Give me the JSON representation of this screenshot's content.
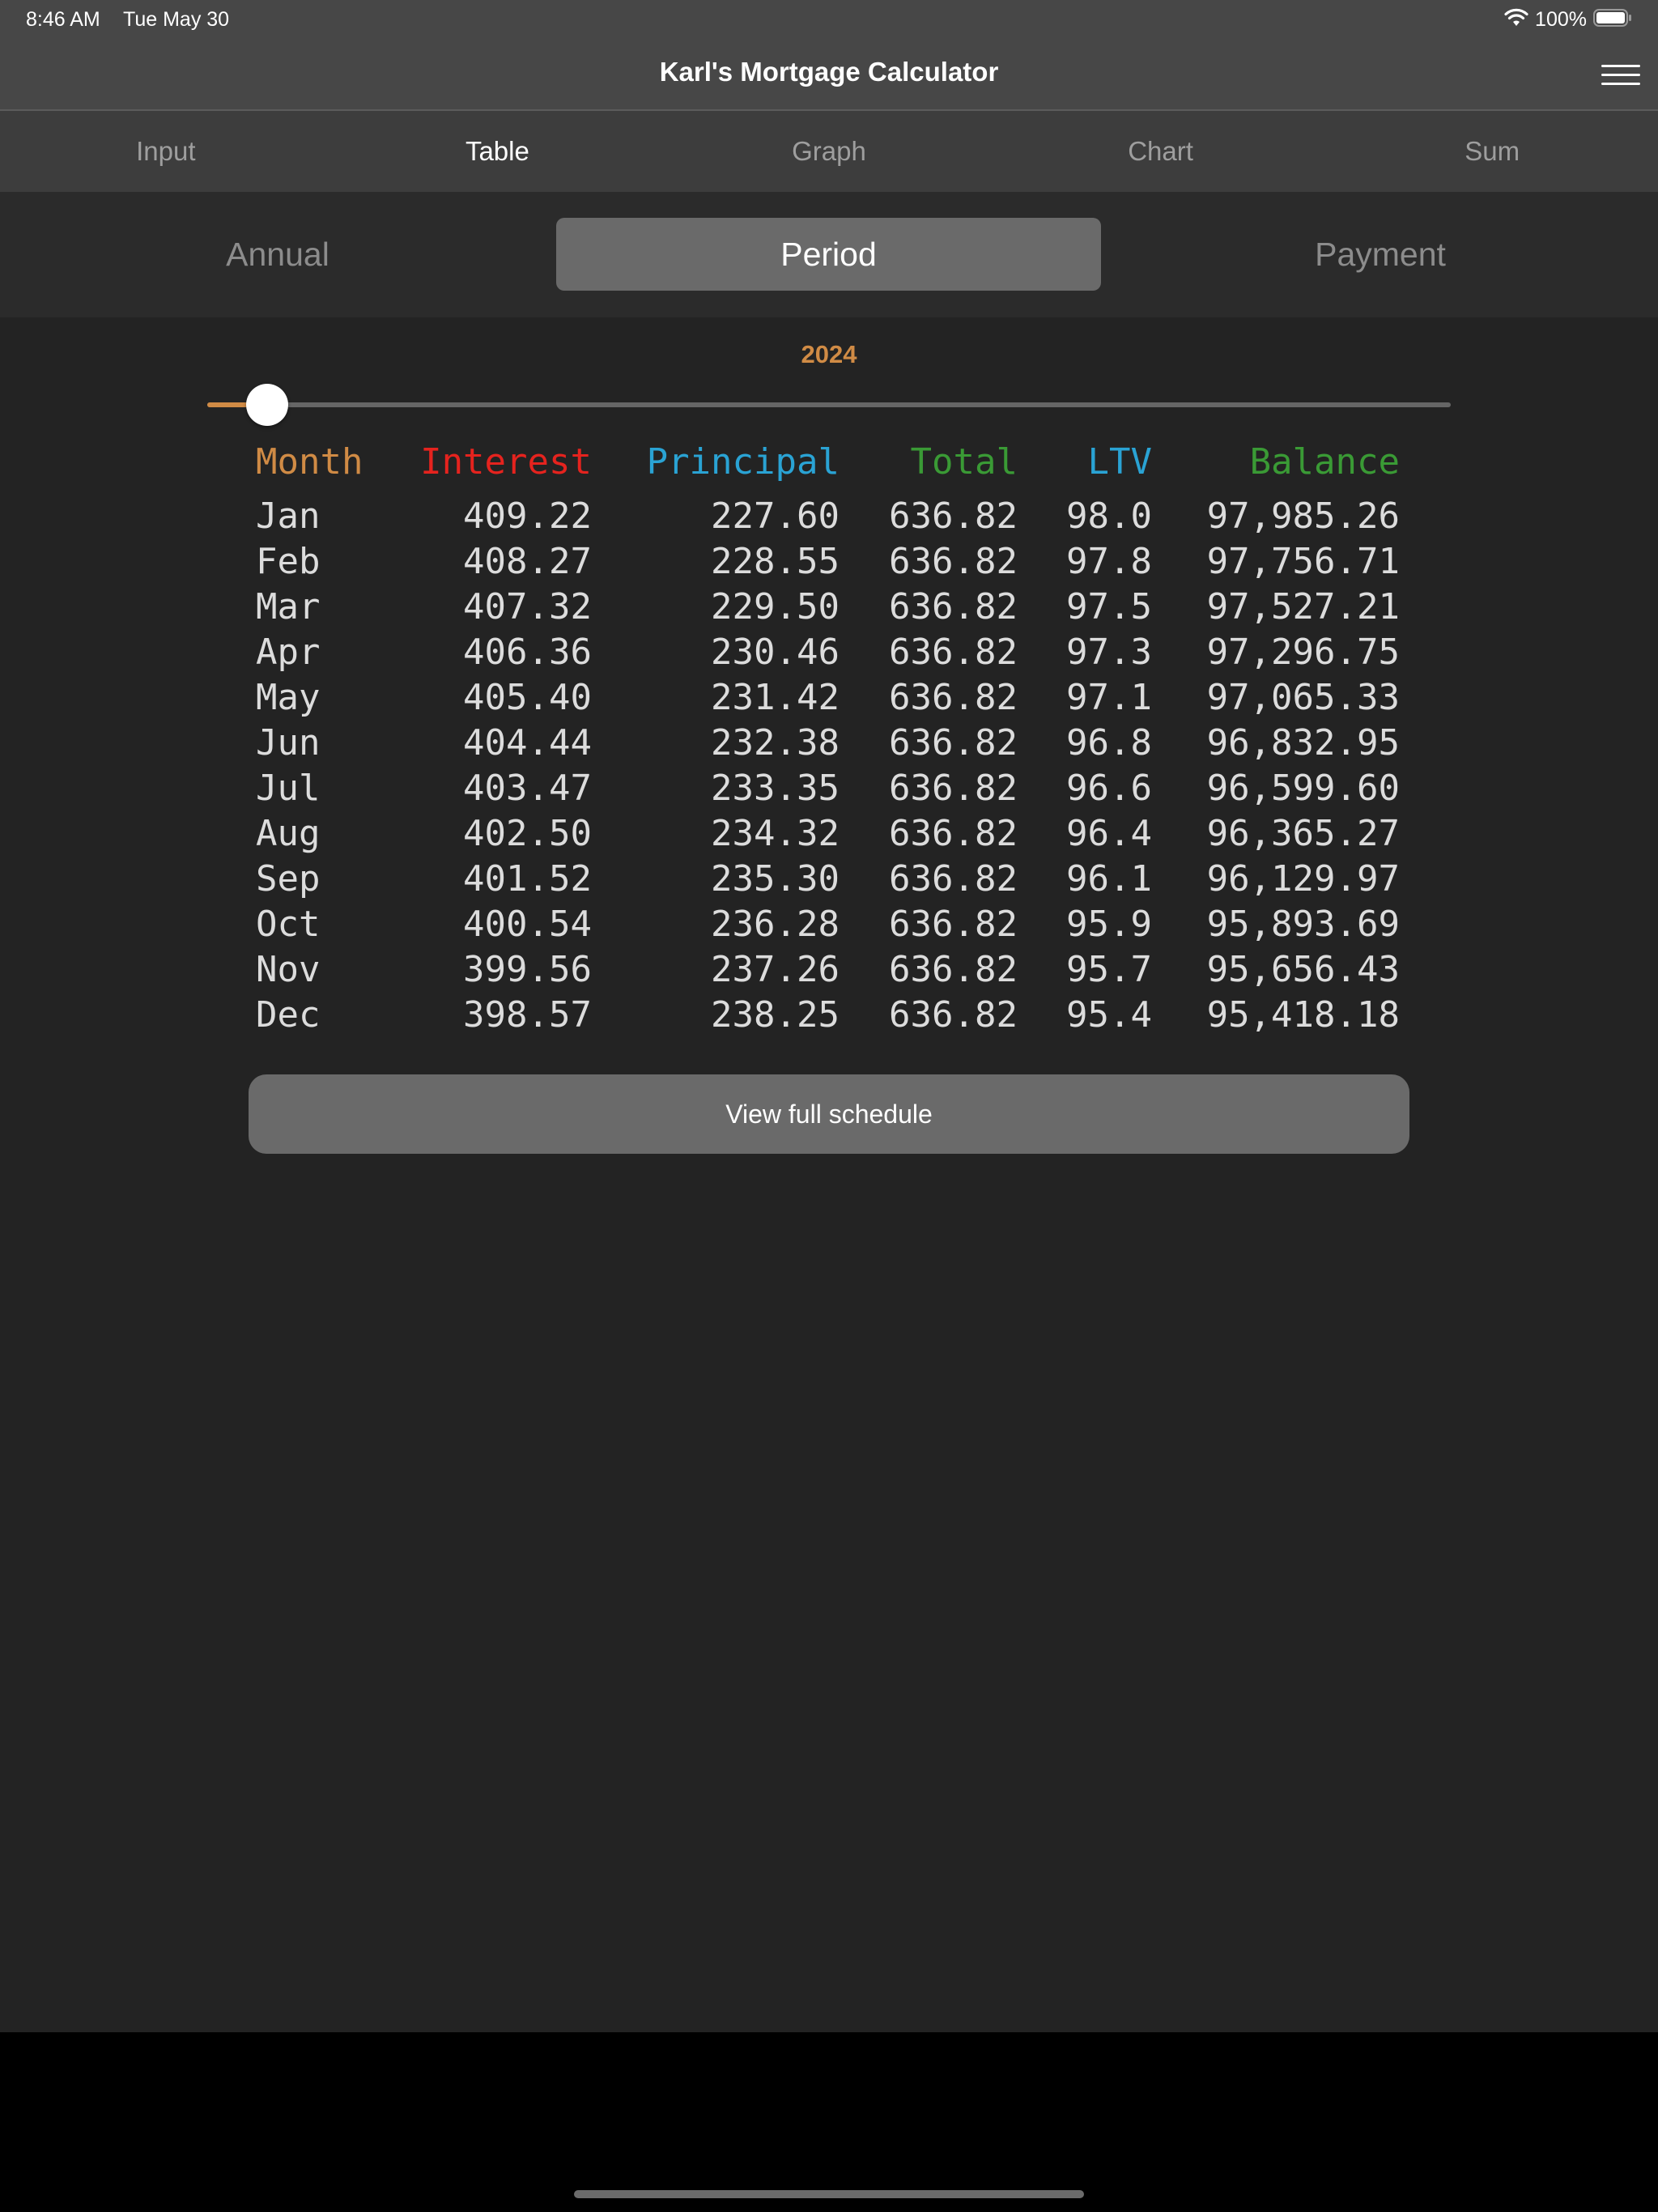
{
  "status_bar": {
    "time": "8:46 AM",
    "date": "Tue May 30",
    "battery": "100%",
    "icons": [
      "wifi-icon",
      "battery-icon"
    ]
  },
  "header": {
    "title": "Karl's Mortgage Calculator",
    "menu_icon": "hamburger-menu-icon"
  },
  "tabs": [
    {
      "label": "Input",
      "active": false
    },
    {
      "label": "Table",
      "active": true
    },
    {
      "label": "Graph",
      "active": false
    },
    {
      "label": "Chart",
      "active": false
    },
    {
      "label": "Sum",
      "active": false
    }
  ],
  "segments": [
    {
      "label": "Annual",
      "selected": false
    },
    {
      "label": "Period",
      "selected": true
    },
    {
      "label": "Payment",
      "selected": false
    }
  ],
  "year_selector": {
    "year": "2024",
    "slider_fraction": 0.048
  },
  "table": {
    "headers": {
      "month": "Month",
      "interest": "Interest",
      "principal": "Principal",
      "total": "Total",
      "ltv": "LTV",
      "balance": "Balance"
    },
    "header_colors": {
      "month": "#d08b45",
      "interest": "#e5231e",
      "principal": "#2aa3d4",
      "total": "#3a9a35",
      "ltv": "#2aa3d4",
      "balance": "#3a9a35"
    },
    "rows": [
      {
        "month": "Jan",
        "interest": "409.22",
        "principal": "227.60",
        "total": "636.82",
        "ltv": "98.0",
        "balance": "97,985.26"
      },
      {
        "month": "Feb",
        "interest": "408.27",
        "principal": "228.55",
        "total": "636.82",
        "ltv": "97.8",
        "balance": "97,756.71"
      },
      {
        "month": "Mar",
        "interest": "407.32",
        "principal": "229.50",
        "total": "636.82",
        "ltv": "97.5",
        "balance": "97,527.21"
      },
      {
        "month": "Apr",
        "interest": "406.36",
        "principal": "230.46",
        "total": "636.82",
        "ltv": "97.3",
        "balance": "97,296.75"
      },
      {
        "month": "May",
        "interest": "405.40",
        "principal": "231.42",
        "total": "636.82",
        "ltv": "97.1",
        "balance": "97,065.33"
      },
      {
        "month": "Jun",
        "interest": "404.44",
        "principal": "232.38",
        "total": "636.82",
        "ltv": "96.8",
        "balance": "96,832.95"
      },
      {
        "month": "Jul",
        "interest": "403.47",
        "principal": "233.35",
        "total": "636.82",
        "ltv": "96.6",
        "balance": "96,599.60"
      },
      {
        "month": "Aug",
        "interest": "402.50",
        "principal": "234.32",
        "total": "636.82",
        "ltv": "96.4",
        "balance": "96,365.27"
      },
      {
        "month": "Sep",
        "interest": "401.52",
        "principal": "235.30",
        "total": "636.82",
        "ltv": "96.1",
        "balance": "96,129.97"
      },
      {
        "month": "Oct",
        "interest": "400.54",
        "principal": "236.28",
        "total": "636.82",
        "ltv": "95.9",
        "balance": "95,893.69"
      },
      {
        "month": "Nov",
        "interest": "399.56",
        "principal": "237.26",
        "total": "636.82",
        "ltv": "95.7",
        "balance": "95,656.43"
      },
      {
        "month": "Dec",
        "interest": "398.57",
        "principal": "238.25",
        "total": "636.82",
        "ltv": "95.4",
        "balance": "95,418.18"
      }
    ]
  },
  "full_schedule_button": {
    "label": "View full schedule"
  },
  "colors": {
    "accent_orange": "#d08b45",
    "background": "#232323",
    "header_bar": "#474747",
    "tab_bar": "#3d3d3d",
    "selected_segment": "#6a6a6a"
  }
}
